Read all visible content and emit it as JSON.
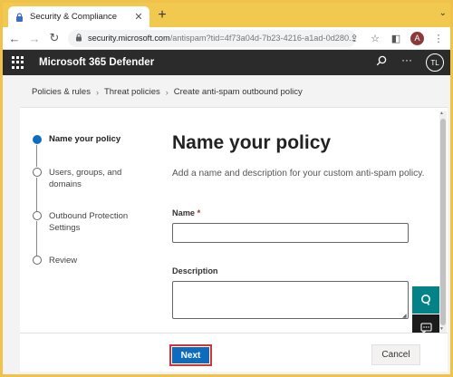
{
  "browser": {
    "tab_title": "Security & Compliance",
    "url_host": "security.microsoft.com",
    "url_path": "/antispam?tid=4f73a04d-7b23-4216-a1ad-0d280...",
    "profile_initial": "A"
  },
  "app": {
    "title": "Microsoft 365 Defender",
    "user_initials": "TL"
  },
  "breadcrumb": [
    "Policies & rules",
    "Threat policies",
    "Create anti-spam outbound policy"
  ],
  "steps": [
    {
      "label": "Name your policy",
      "active": true
    },
    {
      "label": "Users, groups, and domains",
      "active": false
    },
    {
      "label": "Outbound Protection Settings",
      "active": false
    },
    {
      "label": "Review",
      "active": false
    }
  ],
  "form": {
    "heading": "Name your policy",
    "description": "Add a name and description for your custom anti-spam policy.",
    "name_label": "Name",
    "name_required": "*",
    "name_value": "",
    "description_label": "Description",
    "description_value": ""
  },
  "footer": {
    "next_label": "Next",
    "cancel_label": "Cancel"
  },
  "colors": {
    "accent": "#0f6cbd",
    "appbar": "#2b2b2b",
    "highlight": "#d13438",
    "teal": "#038387"
  }
}
